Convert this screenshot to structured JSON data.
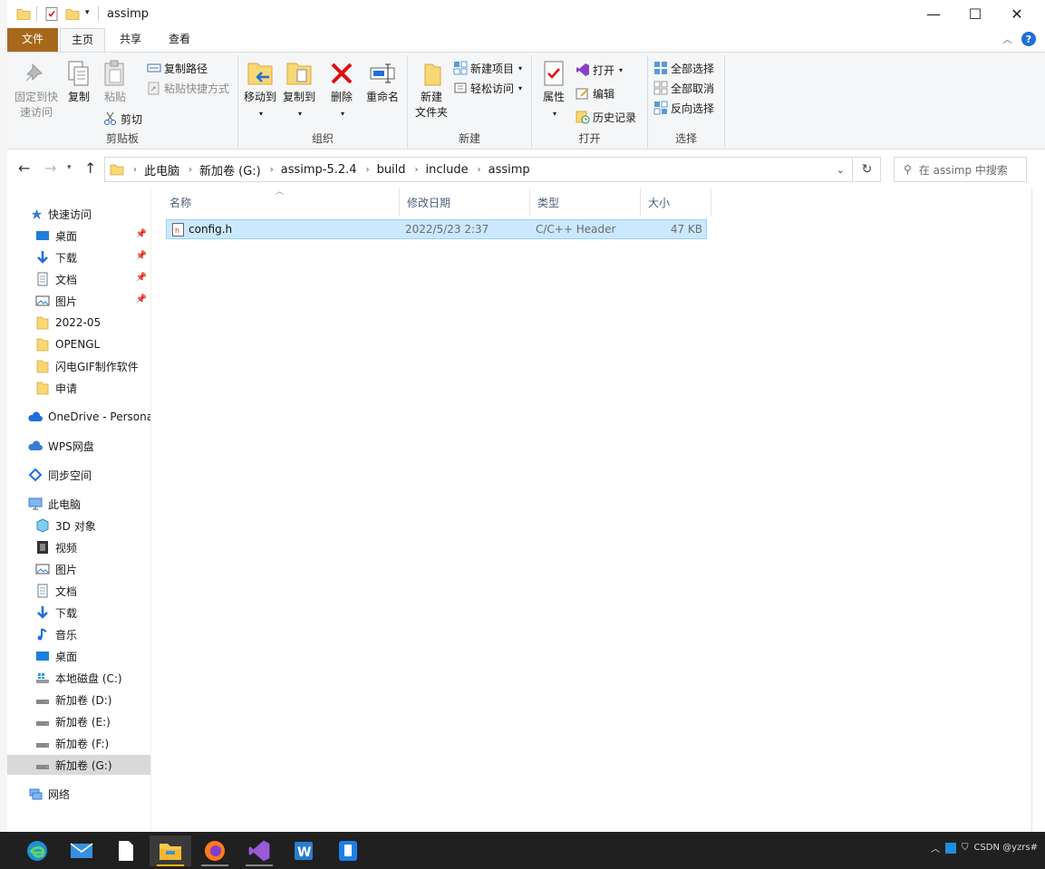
{
  "window": {
    "title": "assimp"
  },
  "window_controls": {
    "minimize": "—",
    "maximize": "☐",
    "close": "✕"
  },
  "ribbon_tabs": {
    "file": "文件",
    "home": "主页",
    "share": "共享",
    "view": "查看"
  },
  "ribbon": {
    "clipboard": {
      "label": "剪贴板",
      "pin_quick_access_line1": "固定到快",
      "pin_quick_access_line2": "速访问",
      "copy": "复制",
      "paste": "粘贴",
      "copy_path": "复制路径",
      "paste_shortcut": "粘贴快捷方式",
      "cut": "剪切"
    },
    "organize": {
      "label": "组织",
      "move_to": "移动到",
      "copy_to": "复制到",
      "delete": "删除",
      "rename": "重命名"
    },
    "new": {
      "label": "新建",
      "new_folder_line1": "新建",
      "new_folder_line2": "文件夹",
      "new_item": "新建项目",
      "easy_access": "轻松访问"
    },
    "open": {
      "label": "打开",
      "properties": "属性",
      "open": "打开",
      "edit": "编辑",
      "history": "历史记录"
    },
    "select": {
      "label": "选择",
      "select_all": "全部选择",
      "select_none": "全部取消",
      "invert": "反向选择"
    }
  },
  "address": {
    "crumbs": [
      "此电脑",
      "新加卷 (G:)",
      "assimp-5.2.4",
      "build",
      "include",
      "assimp"
    ]
  },
  "search": {
    "placeholder": "在 assimp 中搜索"
  },
  "nav": {
    "quick_access": "快速访问",
    "quick_items": [
      "桌面",
      "下载",
      "文档",
      "图片",
      "2022-05",
      "OPENGL",
      "闪电GIF制作软件",
      "申请"
    ],
    "onedrive": "OneDrive - Persona",
    "wps": "WPS网盘",
    "sync": "同步空间",
    "this_pc": "此电脑",
    "pc_items": [
      "3D 对象",
      "视频",
      "图片",
      "文档",
      "下载",
      "音乐",
      "桌面",
      "本地磁盘 (C:)",
      "新加卷 (D:)",
      "新加卷 (E:)",
      "新加卷 (F:)",
      "新加卷 (G:)"
    ],
    "network": "网络"
  },
  "columns": {
    "name": "名称",
    "modified": "修改日期",
    "type": "类型",
    "size": "大小"
  },
  "files": [
    {
      "name": "config.h",
      "modified": "2022/5/23 2:37",
      "type": "C/C++ Header",
      "size": "47 KB"
    }
  ],
  "taskbar": {
    "tray_text": "CSDN @yzrs#"
  },
  "colors": {
    "file_tab": "#a8681c",
    "selection": "#cce8ff",
    "taskbar": "#202020"
  }
}
